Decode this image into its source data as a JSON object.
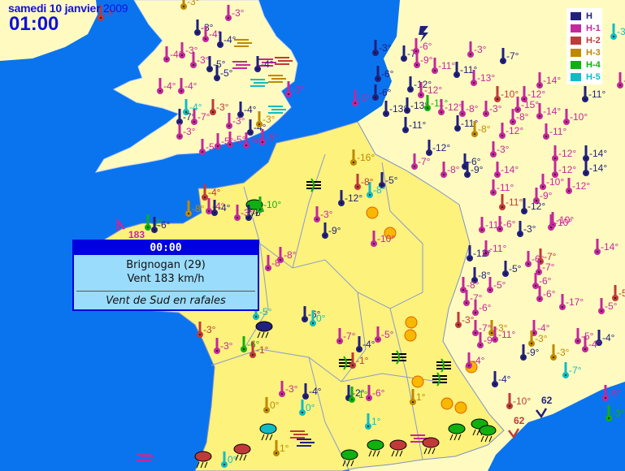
{
  "header": {
    "date": "samedi 10 janvier",
    "year": "2009",
    "time": "01:00"
  },
  "legend": [
    {
      "label": "H",
      "color": "#22207e"
    },
    {
      "label": "H-1",
      "color": "#c4289c"
    },
    {
      "label": "H-2",
      "color": "#c03a3a"
    },
    {
      "label": "H-3",
      "color": "#c08800"
    },
    {
      "label": "H-4",
      "color": "#10b010"
    },
    {
      "label": "H-5",
      "color": "#10bcc4"
    }
  ],
  "colors": {
    "sea": "#0a74ef",
    "france": "#fcf27c",
    "land": "#fffbc0",
    "sun": "#f8b800"
  },
  "tooltip": {
    "time": "00:00",
    "station": "Brignogan (29)",
    "wind": "Vent 183 km/h",
    "info": "Vent de Sud en rafales"
  },
  "markers": [
    {
      "t": "-3°",
      "s": 3
    },
    {
      "t": "-3°",
      "s": 2
    },
    {
      "t": "-3°",
      "s": 1
    },
    {
      "t": "-3°",
      "s": 0
    },
    {
      "t": "-4°",
      "s": 1
    },
    {
      "t": "-4°",
      "s": 0
    },
    {
      "t": "-4°",
      "s": 1
    },
    {
      "t": "-3°",
      "s": 1
    },
    {
      "t": "-3°",
      "s": 1
    },
    {
      "t": "-5°",
      "s": 0
    },
    {
      "t": "-5°",
      "s": 0
    },
    {
      "t": "-4°",
      "s": 1
    },
    {
      "t": "-4°",
      "s": 1
    },
    {
      "t": "-4°",
      "s": 5
    },
    {
      "t": "-3°",
      "s": 2
    },
    {
      "t": "-4°",
      "s": 0
    },
    {
      "t": "-7°",
      "s": 0
    },
    {
      "t": "-7°",
      "s": 1
    },
    {
      "t": "-3°",
      "s": 1
    },
    {
      "t": "-3°",
      "s": 1
    },
    {
      "t": "-4°",
      "s": 0
    },
    {
      "t": "-3°",
      "s": 3
    },
    {
      "t": "-3°",
      "s": 1
    },
    {
      "t": "-5°",
      "s": 1
    },
    {
      "t": "-5°",
      "s": 1
    },
    {
      "t": "-5°",
      "s": 1
    },
    {
      "t": "-6°",
      "s": 1
    },
    {
      "t": "-5°",
      "s": 1
    },
    {
      "t": "-4°",
      "s": 0
    },
    {
      "t": "-5°",
      "s": 1
    },
    {
      "t": "-3°",
      "s": 0
    },
    {
      "t": "-7°",
      "s": 0
    },
    {
      "t": "-6°",
      "s": 1
    },
    {
      "t": "-9°",
      "s": 1
    },
    {
      "t": "-3°",
      "s": 1
    },
    {
      "t": "-11°",
      "s": 1
    },
    {
      "t": "-11°",
      "s": 0
    },
    {
      "t": "-7°",
      "s": 0
    },
    {
      "t": "-6°",
      "s": 0
    },
    {
      "t": "-13°",
      "s": 1
    },
    {
      "t": "-6°",
      "s": 0
    },
    {
      "t": "-12°",
      "s": 0
    },
    {
      "t": "-12°",
      "s": 1
    },
    {
      "t": "-13°",
      "s": 0
    },
    {
      "t": "-13°",
      "s": 0
    },
    {
      "t": "-11°",
      "s": 4
    },
    {
      "t": "-12°",
      "s": 1
    },
    {
      "t": "-8°",
      "s": 1
    },
    {
      "t": "-3°",
      "s": 1
    },
    {
      "t": "-10°",
      "s": 2
    },
    {
      "t": "-12°",
      "s": 1
    },
    {
      "t": "-15°",
      "s": 1
    },
    {
      "t": "-14°",
      "s": 1
    },
    {
      "t": "-8°",
      "s": 1
    },
    {
      "t": "-14°",
      "s": 1
    },
    {
      "t": "-11°",
      "s": 0
    },
    {
      "t": "-9°",
      "s": 1
    },
    {
      "t": "-11°",
      "s": 0
    },
    {
      "t": "-11°",
      "s": 0
    },
    {
      "t": "-8°",
      "s": 3
    },
    {
      "t": "-12°",
      "s": 1
    },
    {
      "t": "-10°",
      "s": 1
    },
    {
      "t": "-11°",
      "s": 1
    },
    {
      "t": "-12°",
      "s": 0
    },
    {
      "t": "-7°",
      "s": 1
    },
    {
      "t": "-8°",
      "s": 1
    },
    {
      "t": "-6°",
      "s": 0
    },
    {
      "t": "-9°",
      "s": 0
    },
    {
      "t": "-3°",
      "s": 1
    },
    {
      "t": "-14°",
      "s": 1
    },
    {
      "t": "-12°",
      "s": 1
    },
    {
      "t": "-12°",
      "s": 1
    },
    {
      "t": "-14°",
      "s": 0
    },
    {
      "t": "-14°",
      "s": 0
    },
    {
      "t": "-12°",
      "s": 1
    },
    {
      "t": "-10°",
      "s": 1
    },
    {
      "t": "-9°",
      "s": 1
    },
    {
      "t": "-11°",
      "s": 1
    },
    {
      "t": "-11°",
      "s": 2
    },
    {
      "t": "-12°",
      "s": 0
    },
    {
      "t": "-10°",
      "s": 1
    },
    {
      "t": "-11°",
      "s": 1
    },
    {
      "t": "-6°",
      "s": 1
    },
    {
      "t": "-3°",
      "s": 0
    },
    {
      "t": "-10°",
      "s": 1
    },
    {
      "t": "-14°",
      "s": 1
    },
    {
      "t": "-11°",
      "s": 1
    },
    {
      "t": "-12°",
      "s": 0
    },
    {
      "t": "-6°",
      "s": 1
    },
    {
      "t": "-7°",
      "s": 2
    },
    {
      "t": "-7°",
      "s": 1
    },
    {
      "t": "-5°",
      "s": 0
    },
    {
      "t": "-8°",
      "s": 0
    },
    {
      "t": "-6°",
      "s": 1
    },
    {
      "t": "-6°",
      "s": 1
    },
    {
      "t": "-17°",
      "s": 1
    },
    {
      "t": "-5°",
      "s": 1
    },
    {
      "t": "-5°",
      "s": 2
    },
    {
      "t": "-8°",
      "s": 1
    },
    {
      "t": "-5°",
      "s": 1
    },
    {
      "t": "-7°",
      "s": 1
    },
    {
      "t": "-6°",
      "s": 1
    },
    {
      "t": "-3°",
      "s": 2
    },
    {
      "t": "-7°",
      "s": 1
    },
    {
      "t": "-3°",
      "s": 3
    },
    {
      "t": "-11°",
      "s": 1
    },
    {
      "t": "-4°",
      "s": 1
    },
    {
      "t": "-3°",
      "s": 3
    },
    {
      "t": "-9°",
      "s": 1
    },
    {
      "t": "-9°",
      "s": 0
    },
    {
      "t": "-3°",
      "s": 3
    },
    {
      "t": "-5°",
      "s": 1
    },
    {
      "t": "-4°",
      "s": 0
    },
    {
      "t": "-4°",
      "s": 1
    },
    {
      "t": "-7°",
      "s": 5
    },
    {
      "t": "-4°",
      "s": 0
    },
    {
      "t": "-4°",
      "s": 1
    },
    {
      "t": "-3°",
      "s": 5
    },
    {
      "t": "-3°",
      "s": 4
    },
    {
      "t": "-6°",
      "s": 1
    },
    {
      "t": "-10°",
      "s": 2
    },
    {
      "t": "-6°",
      "s": 0
    },
    {
      "t": "-4°",
      "s": 2
    },
    {
      "t": "-8°",
      "s": 3
    },
    {
      "t": "-4°",
      "s": 1
    },
    {
      "t": "-4°",
      "s": 0
    },
    {
      "t": "-2°",
      "s": 4
    },
    {
      "t": "-6°",
      "s": 0
    },
    {
      "t": "-3°",
      "s": 1
    },
    {
      "t": "-6°",
      "s": 0
    },
    {
      "t": "0°",
      "s": 5
    },
    {
      "t": "-3°",
      "s": 2
    },
    {
      "t": "-3°",
      "s": 1
    },
    {
      "t": "-6°",
      "s": 4
    },
    {
      "t": "-1°",
      "s": 2
    },
    {
      "t": "-7°",
      "s": 1
    },
    {
      "t": "-4°",
      "s": 0
    },
    {
      "t": "-5°",
      "s": 1
    },
    {
      "t": "-1°",
      "s": 2
    },
    {
      "t": "-3°",
      "s": 1
    },
    {
      "t": "-4°",
      "s": 0
    },
    {
      "t": "0°",
      "s": 3
    },
    {
      "t": "0°",
      "s": 5
    },
    {
      "t": "-2°",
      "s": 0
    },
    {
      "t": "-1°",
      "s": 4
    },
    {
      "t": "-6°",
      "s": 1
    },
    {
      "t": "1°",
      "s": 5
    },
    {
      "t": "1°",
      "s": 3
    },
    {
      "t": "0°",
      "s": 5
    },
    {
      "t": "-5°",
      "s": 5
    },
    {
      "t": "-8°",
      "s": 1
    },
    {
      "t": "-8°",
      "s": 1
    },
    {
      "t": "-10°",
      "s": 4
    },
    {
      "t": "-9°",
      "s": 0
    },
    {
      "t": "-12°",
      "s": 0
    },
    {
      "t": "-16°",
      "s": 3
    },
    {
      "t": "-5°",
      "s": 0
    },
    {
      "t": "-8°",
      "s": 5
    },
    {
      "t": "-3°",
      "s": 1
    },
    {
      "t": "1°",
      "s": 3
    },
    {
      "t": "-8°",
      "s": 2
    },
    {
      "t": "-10°",
      "s": 1
    }
  ],
  "wind_labels": [
    {
      "t": "62",
      "s": 0
    },
    {
      "t": "62",
      "s": 2
    },
    {
      "t": "183",
      "s": 1
    }
  ]
}
